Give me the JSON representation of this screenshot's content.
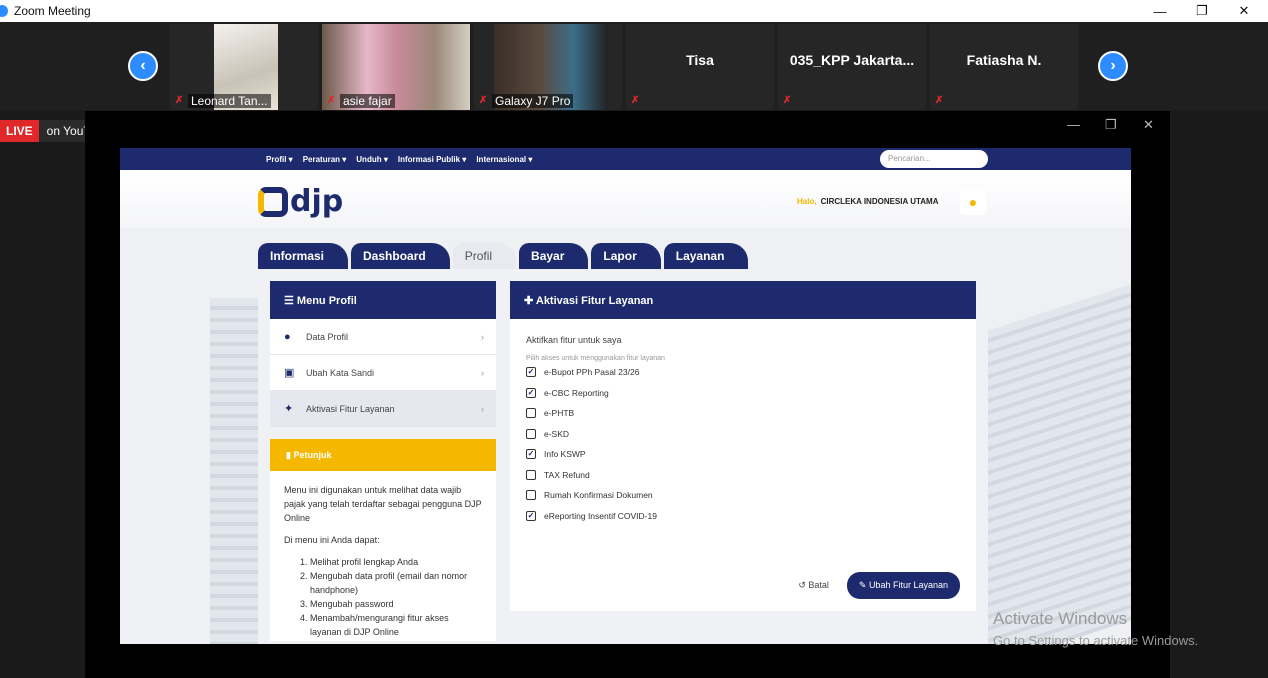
{
  "window": {
    "title": "Zoom Meeting",
    "minimize": "—",
    "restore": "❐",
    "close": "✕"
  },
  "participants": [
    {
      "name": "Leonard Tan..."
    },
    {
      "name": "asie fajar"
    },
    {
      "name": "Galaxy J7 Pro"
    },
    {
      "name": "Tisa"
    },
    {
      "name": "035_KPP Jakarta..."
    },
    {
      "name": "Fatiasha N."
    }
  ],
  "live": {
    "badge": "LIVE",
    "platform": "on YouTube ▾"
  },
  "share_controls": {
    "minimize": "—",
    "restore": "❐",
    "close": "✕"
  },
  "site": {
    "topnav": [
      "Profil ▾",
      "Peraturan ▾",
      "Unduh ▾",
      "Informasi Publik ▾",
      "Internasional ▾"
    ],
    "search_placeholder": "Pencarian...",
    "logo_text": "djp",
    "greeting": "Halo,",
    "user_name": "CIRCLEKA INDONESIA UTAMA",
    "tabs": [
      "Informasi",
      "Dashboard",
      "Profil",
      "Bayar",
      "Lapor",
      "Layanan"
    ],
    "active_tab": "Profil",
    "menu": {
      "title": "Menu Profil",
      "items": [
        {
          "label": "Data Profil"
        },
        {
          "label": "Ubah Kata Sandi"
        },
        {
          "label": "Aktivasi Fitur Layanan"
        }
      ]
    },
    "petunjuk": {
      "title": "Petunjuk",
      "intro": "Menu ini digunakan untuk melihat data wajib pajak yang telah terdaftar sebagai pengguna DJP Online",
      "sub": "Di menu ini Anda dapat:",
      "list": [
        "Melihat profil lengkap Anda",
        "Mengubah data profil (email dan nomor handphone)",
        "Mengubah password",
        "Menambah/mengurangi fitur akses layanan di DJP Online"
      ]
    },
    "aktivasi": {
      "title": "Aktivasi Fitur Layanan",
      "label": "Aktifkan fitur untuk saya",
      "hint": "Pilih akses untuk menggunakan fitur layanan",
      "options": [
        {
          "label": "e-Bupot PPh Pasal 23/26",
          "checked": true
        },
        {
          "label": "e-CBC Reporting",
          "checked": true
        },
        {
          "label": "e-PHTB",
          "checked": false
        },
        {
          "label": "e-SKD",
          "checked": false
        },
        {
          "label": "Info KSWP",
          "checked": true
        },
        {
          "label": "TAX Refund",
          "checked": false
        },
        {
          "label": "Rumah Konfirmasi Dokumen",
          "checked": false
        },
        {
          "label": "eReporting Insentif COVID-19",
          "checked": true
        }
      ],
      "cancel": "Batal",
      "submit": "Ubah Fitur Layanan"
    }
  },
  "watermark": {
    "line1": "Activate Windows",
    "line2": "Go to Settings to activate Windows."
  },
  "colors": {
    "navy": "#1d2a6d",
    "yellow": "#f5b800",
    "zoom_blue": "#2d8cff",
    "live_red": "#e02828"
  }
}
